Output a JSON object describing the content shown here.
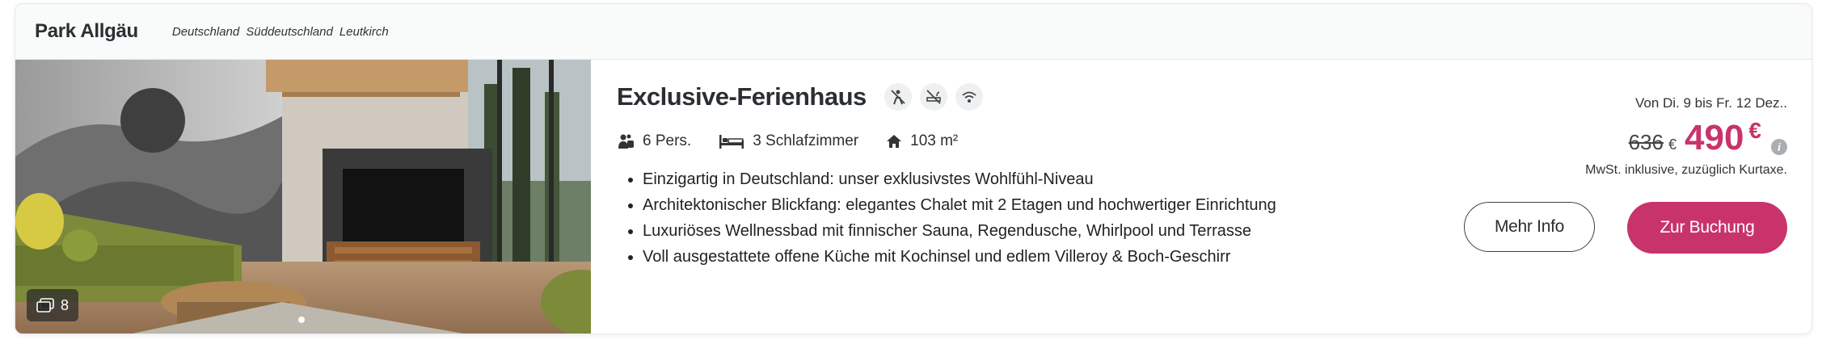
{
  "header": {
    "park_name": "Park Allgäu",
    "breadcrumbs": [
      "Deutschland",
      "Süddeutschland",
      "Leutkirch"
    ]
  },
  "gallery": {
    "photo_count": "8",
    "photo_count_icon": "gallery-stack-icon"
  },
  "listing": {
    "title": "Exclusive-Ferienhaus",
    "amenity_icons": [
      "no-pets-icon",
      "no-smoking-icon",
      "wifi-icon"
    ],
    "facts": [
      {
        "icon": "persons-icon",
        "label": "6 Pers."
      },
      {
        "icon": "bed-icon",
        "label": "3 Schlafzimmer"
      },
      {
        "icon": "house-icon",
        "label": "103 m²"
      }
    ],
    "features": [
      "Einzigartig in Deutschland: unser exklusivstes Wohlfühl-Niveau",
      "Architektonischer Blickfang: elegantes Chalet mit 2 Etagen und hochwertiger Einrichtung",
      "Luxuriöses Wellnessbad mit finnischer Sauna, Regendusche, Whirlpool und Terrasse",
      "Voll ausgestattete offene Küche mit Kochinsel und edlem Villeroy & Boch-Geschirr"
    ]
  },
  "pricing": {
    "dates": "Von Di. 9 bis Fr. 12 Dez..",
    "old_price": "636",
    "old_currency": "€",
    "new_price": "490",
    "new_currency": "€",
    "info_symbol": "i",
    "tax_note": "MwSt. inklusive, zuzüglich Kurtaxe."
  },
  "actions": {
    "more_info": "Mehr Info",
    "book": "Zur Buchung"
  },
  "colors": {
    "accent": "#c8336b",
    "header_bg": "#f9fafa",
    "text": "#2b2f33"
  }
}
